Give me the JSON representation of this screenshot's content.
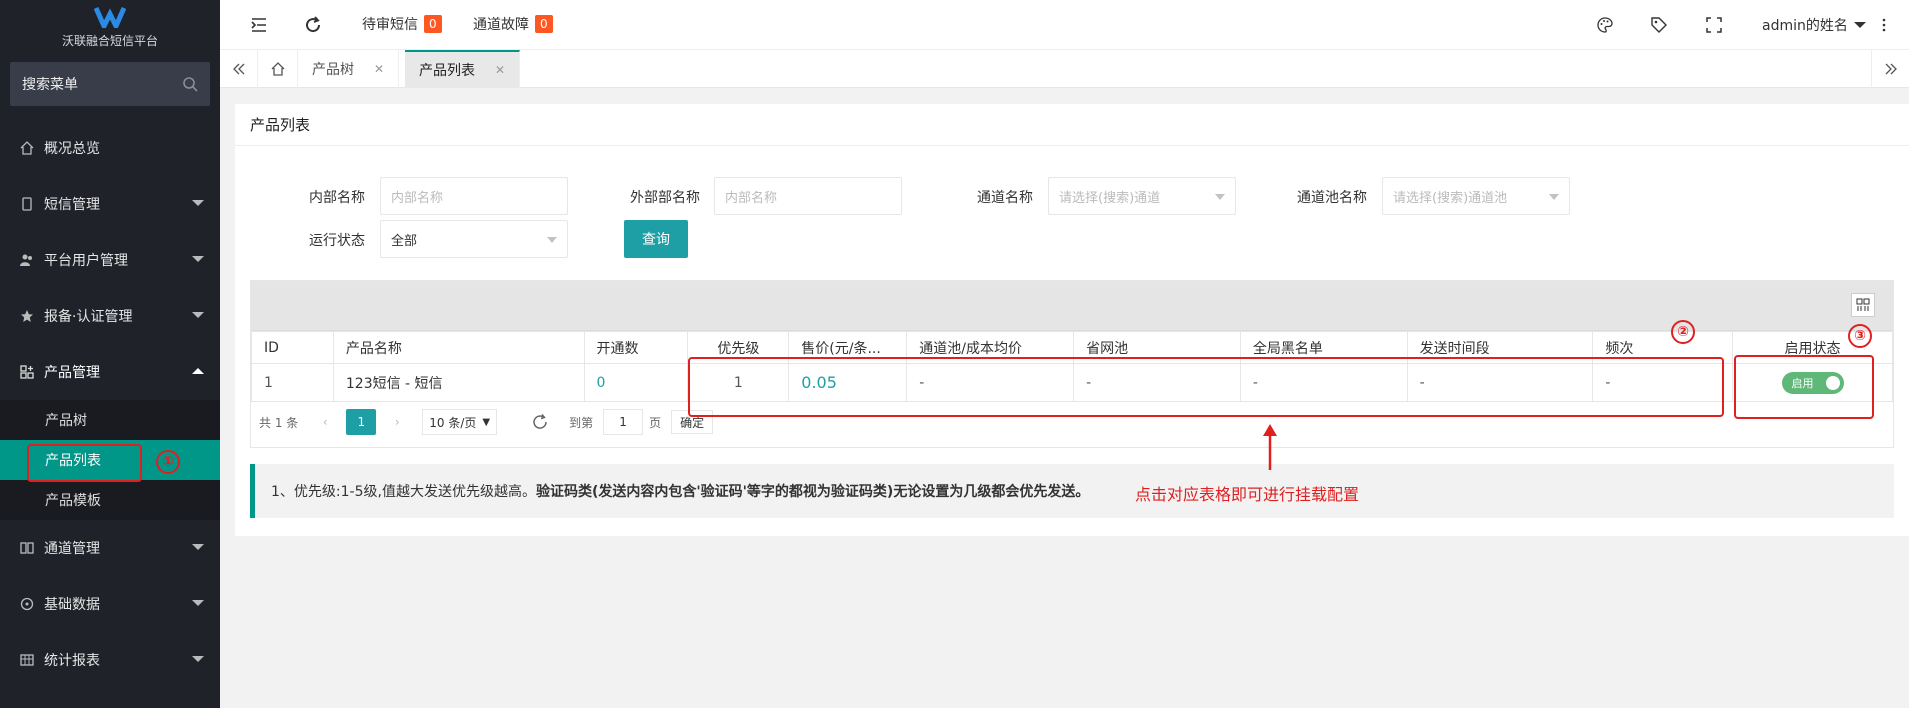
{
  "sidebar": {
    "logo_title": "沃联融合短信平台",
    "search_label": "搜索菜单",
    "items": [
      {
        "label": "概况总览"
      },
      {
        "label": "短信管理"
      },
      {
        "label": "平台用户管理"
      },
      {
        "label": "报备·认证管理"
      },
      {
        "label": "产品管理"
      },
      {
        "label": "通道管理"
      },
      {
        "label": "基础数据"
      },
      {
        "label": "统计报表"
      }
    ],
    "sub_items": [
      {
        "label": "产品树"
      },
      {
        "label": "产品列表"
      },
      {
        "label": "产品模板"
      }
    ],
    "accent_color": "#009688"
  },
  "header": {
    "pending_sms_label": "待审短信",
    "pending_sms_count": "0",
    "channel_fault_label": "通道故障",
    "channel_fault_count": "0",
    "user_name": "admin的姓名"
  },
  "tabs": [
    {
      "label": "产品树"
    },
    {
      "label": "产品列表"
    }
  ],
  "page": {
    "title": "产品列表",
    "filters": {
      "internal_name_label": "内部名称",
      "internal_name_placeholder": "内部名称",
      "external_name_label": "外部部名称",
      "external_name_placeholder": "内部名称",
      "channel_name_label": "通道名称",
      "channel_name_placeholder": "请选择(搜索)通道",
      "channel_pool_label": "通道池名称",
      "channel_pool_placeholder": "请选择(搜索)通道池",
      "run_status_label": "运行状态",
      "run_status_value": "全部",
      "query_button": "查询"
    },
    "table": {
      "headers": [
        "ID",
        "产品名称",
        "开通数",
        "优先级",
        "售价(元/条...",
        "通道池/成本均价",
        "省网池",
        "全局黑名单",
        "发送时间段",
        "频次",
        "启用状态"
      ],
      "rows": [
        {
          "id": "1",
          "name": "123短信 - 短信",
          "opened": "0",
          "priority": "1",
          "price": "0.05",
          "pool": "-",
          "province": "-",
          "blacklist": "-",
          "time": "-",
          "freq": "-",
          "status": "启用"
        }
      ]
    },
    "pager": {
      "total": "共 1 条",
      "current": "1",
      "page_size": "10 条/页",
      "goto_label": "到第",
      "goto_value": "1",
      "page_unit": "页",
      "confirm": "确定"
    },
    "note_prefix": "1、优先级:1-5级,值越大发送优先级越高。",
    "note_bold": "验证码类(发送内容内包含'验证码'等字的都视为验证码类)无论设置为几级都会优先发送。",
    "hint": "点击对应表格即可进行挂载配置"
  },
  "annotations": {
    "marker_1": "①",
    "marker_2": "②",
    "marker_3": "③"
  }
}
